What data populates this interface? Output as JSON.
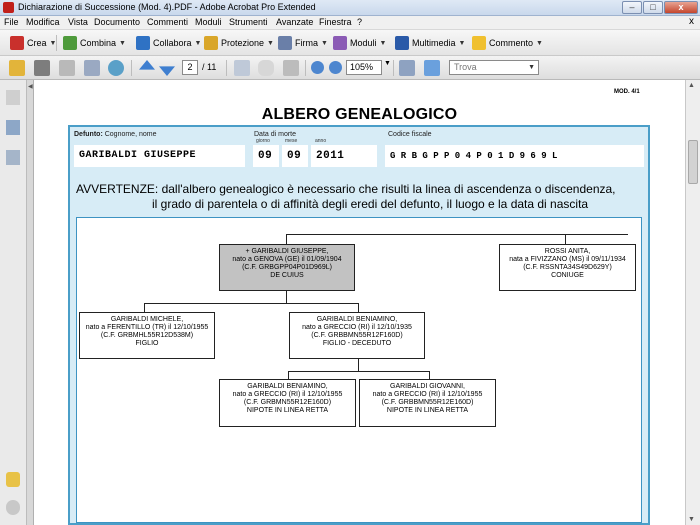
{
  "window": {
    "title": "Dichiarazione di Successione (Mod. 4).PDF - Adobe Acrobat Pro Extended",
    "min": "–",
    "max": "□",
    "close": "x"
  },
  "menu": [
    "File",
    "Modifica",
    "Vista",
    "Documento",
    "Commenti",
    "Moduli",
    "Strumenti",
    "Avanzate",
    "Finestra",
    "?"
  ],
  "menu_close": "x",
  "toolbar_tasks": [
    {
      "label": "Crea",
      "icon": "create-pdf-icon"
    },
    {
      "label": "Combina",
      "icon": "combine-icon"
    },
    {
      "label": "Collabora",
      "icon": "collaborate-icon"
    },
    {
      "label": "Protezione",
      "icon": "lock-icon"
    },
    {
      "label": "Firma",
      "icon": "pen-icon"
    },
    {
      "label": "Moduli",
      "icon": "forms-icon"
    },
    {
      "label": "Multimedia",
      "icon": "multimedia-icon"
    },
    {
      "label": "Commento",
      "icon": "comment-icon"
    }
  ],
  "nav": {
    "current_page": "2",
    "total_pages": "/ 11",
    "zoom": "105%",
    "find_placeholder": "Trova"
  },
  "document": {
    "mod_tag": "MOD. 4/1",
    "title": "ALBERO GENEALOGICO",
    "labels": {
      "defunto": "Defunto:",
      "defunto_rest": " Cognome, nome",
      "data_morte": "Data di morte",
      "codice_fiscale": "Codice fiscale",
      "giorno": "giorno",
      "mese": "mese",
      "anno": "anno"
    },
    "values": {
      "nome": "GARIBALDI GIUSEPPE",
      "giorno": "09",
      "mese": "09",
      "anno": "2011",
      "codice_fiscale": "G R B G P P 0 4 P 0 1 D 9 6 9 L"
    },
    "warning_line1": "AVVERTENZE: dall'albero genealogico è necessario che risulti la linea di ascendenza o discendenza,",
    "warning_line2": "il grado di parentela o di affinità degli eredi del defunto, il luogo e la data di nascita"
  },
  "tree": {
    "giuseppe": [
      "+ GARIBALDI GIUSEPPE,",
      "nato a GENOVA (GE) il 01/09/1904",
      "(C.F. GRBGPP04P01D969L)",
      "DE CUIUS"
    ],
    "anita": [
      "ROSSI ANITA,",
      "nata a FIVIZZANO (MS) il 09/11/1934",
      "(C.F. RSSNTA34S49D629Y)",
      "CONIUGE"
    ],
    "michele": [
      "GARIBALDI MICHELE,",
      "nato a FERENTILLO (TR) il 12/10/1955",
      "(C.F. GRBMHL55R12D538M)",
      "FIGLIO"
    ],
    "beniamino_figlio": [
      "GARIBALDI BENIAMINO,",
      "nato a GRECCIO (RI) il 12/10/1935",
      "(C.F. GRBBMN55R12F160D)",
      "FIGLIO - DECEDUTO"
    ],
    "beniamino_nipote": [
      "GARIBALDI BENIAMINO,",
      "nato a GRECCIO (RI) il 12/10/1955",
      "(C.F. GRBMN55R12E160D)",
      "NIPOTE IN LINEA RETTA"
    ],
    "giovanni": [
      "GARIBALDI GIOVANNI,",
      "nato a GRECCIO (RI) il 12/10/1955",
      "(C.F. GRBBMN55R12E160D)",
      "NIPOTE IN LINEA RETTA"
    ]
  },
  "colors": {
    "frame_border": "#4a9ec8",
    "frame_fill": "#d7ecf6",
    "deceased_box": "#c2c2c2"
  }
}
